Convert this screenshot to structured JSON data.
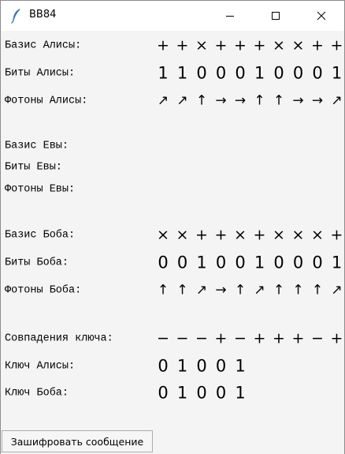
{
  "window": {
    "title": "BB84"
  },
  "rows": [
    {
      "id": "alice-basis",
      "label": "Базис Алисы:",
      "kind": "sym",
      "values": [
        "+",
        "+",
        "×",
        "+",
        "+",
        "+",
        "×",
        "×",
        "+",
        "+"
      ]
    },
    {
      "id": "alice-bits",
      "label": "Биты Алисы:",
      "kind": "dig",
      "values": [
        "1",
        "1",
        "0",
        "0",
        "0",
        "1",
        "0",
        "0",
        "0",
        "1"
      ]
    },
    {
      "id": "alice-photons",
      "label": "Фотоны Алисы:",
      "kind": "arr",
      "values": [
        "↗",
        "↗",
        "↑",
        "→",
        "→",
        "↑",
        "↑",
        "→",
        "→",
        "↗"
      ]
    },
    {
      "id": "eve-basis",
      "label": "Базис Евы:",
      "kind": "sym",
      "values": []
    },
    {
      "id": "eve-bits",
      "label": "Биты Евы:",
      "kind": "dig",
      "values": []
    },
    {
      "id": "eve-photons",
      "label": "Фотоны Евы:",
      "kind": "arr",
      "values": []
    },
    {
      "id": "bob-basis",
      "label": "Базис Боба:",
      "kind": "sym",
      "values": [
        "×",
        "×",
        "+",
        "+",
        "×",
        "+",
        "×",
        "×",
        "×",
        "+"
      ]
    },
    {
      "id": "bob-bits",
      "label": "Биты Боба:",
      "kind": "dig",
      "values": [
        "0",
        "0",
        "1",
        "0",
        "0",
        "1",
        "0",
        "0",
        "0",
        "1"
      ]
    },
    {
      "id": "bob-photons",
      "label": "Фотоны Боба:",
      "kind": "arr",
      "values": [
        "↑",
        "↑",
        "↗",
        "→",
        "↑",
        "↗",
        "↑",
        "↑",
        "↑",
        "↗"
      ]
    },
    {
      "id": "key-match",
      "label": "Совпадения ключа:",
      "kind": "sym",
      "values": [
        "−",
        "−",
        "−",
        "+",
        "−",
        "+",
        "+",
        "+",
        "−",
        "+"
      ]
    },
    {
      "id": "alice-key",
      "label": "Ключ Алисы:",
      "kind": "dig",
      "values": [
        "0",
        "1",
        "0",
        "0",
        "1"
      ]
    },
    {
      "id": "bob-key",
      "label": "Ключ Боба:",
      "kind": "dig",
      "values": [
        "0",
        "1",
        "0",
        "0",
        "1"
      ]
    }
  ],
  "buttons": {
    "encrypt": "Зашифровать сообщение"
  }
}
